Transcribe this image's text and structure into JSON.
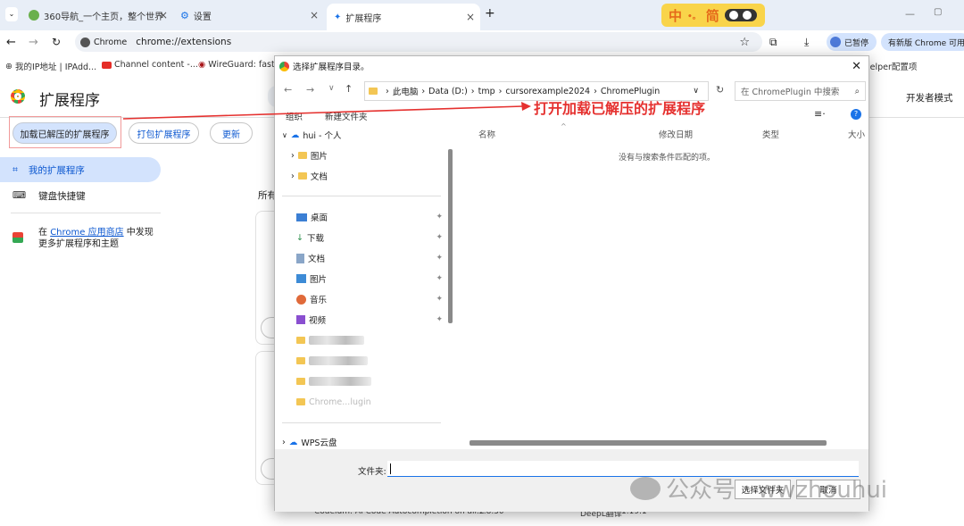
{
  "tabs": [
    {
      "title": "360导航_一个主页，整个世界",
      "active": false
    },
    {
      "title": "设置",
      "active": false
    },
    {
      "title": "扩展程序",
      "active": true
    }
  ],
  "ime": {
    "text": "中",
    "extra": "简"
  },
  "address": {
    "label": "Chrome",
    "url": "chrome://extensions"
  },
  "toolbar": {
    "paused": "已暂停",
    "update_text": "有新版 Chrome 可用"
  },
  "bookmarks": [
    "我的IP地址 | IPAdd...",
    "Channel content -...",
    "WireGuard: fast,...",
    "lelper配置项"
  ],
  "page": {
    "title": "扩展程序",
    "dev_mode": "开发者模式",
    "buttons": {
      "load": "加载已解压的扩展程序",
      "pack": "打包扩展程序",
      "update": "更新"
    },
    "sidebar": {
      "my_ext": "我的扩展程序",
      "shortcuts": "键盘快捷键",
      "store_pre": "在",
      "store_link": "Chrome 应用商店",
      "store_post": "中发现",
      "store_line2": "更多扩展程序和主题"
    },
    "all_label": "所有",
    "bottom_ext": "Codeium: AI Code Autocompletion on all...",
    "bottom_ver": "1.8.30",
    "bottom_ext2": "DeepL翻译",
    "bottom_ver2": "1.19.1"
  },
  "dialog": {
    "title": "选择扩展程序目录。",
    "path": [
      "此电脑",
      "Data (D:)",
      "tmp",
      "cursorexample2024",
      "ChromePlugin"
    ],
    "search_placeholder": "在 ChromePlugin 中搜索",
    "organize": "组织",
    "new_folder": "新建文件夹",
    "tree": {
      "user": "hui - 个人",
      "pictures": "图片",
      "docs": "文档",
      "desktop": "桌面",
      "downloads": "下载",
      "docs2": "文档",
      "pictures2": "图片",
      "music": "音乐",
      "videos": "视频",
      "chrome": "Chrome...lugin",
      "wps": "WPS云盘"
    },
    "columns": {
      "name": "名称",
      "modified": "修改日期",
      "type": "类型",
      "size": "大小"
    },
    "empty": "没有与搜索条件匹配的项。",
    "folder_label": "文件夹:",
    "select_btn": "选择文件夹",
    "cancel_btn": "取消"
  },
  "annotation": "打开加载已解压的扩展程序",
  "watermark": "公众号 · wwzhouhui",
  "colors": {
    "accent": "#0b57d0",
    "annot": "#e5312f"
  }
}
